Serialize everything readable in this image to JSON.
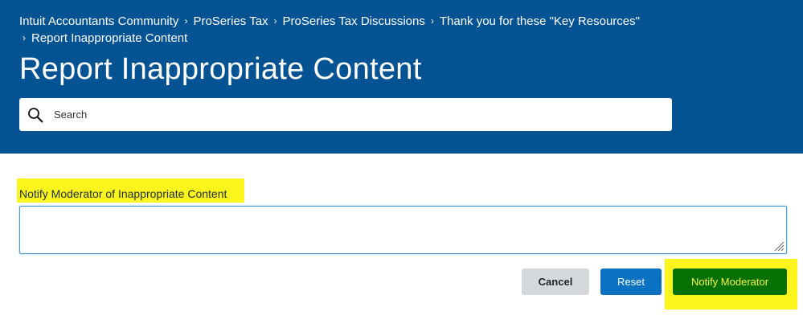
{
  "breadcrumb": {
    "items": [
      "Intuit Accountants Community",
      "ProSeries Tax",
      "ProSeries Tax Discussions",
      "Thank you for these \"Key Resources\"",
      "Report Inappropriate Content"
    ],
    "separator": "›"
  },
  "page": {
    "title": "Report Inappropriate Content"
  },
  "search": {
    "placeholder": "Search",
    "value": ""
  },
  "form": {
    "label": "Notify Moderator of Inappropriate Content",
    "textarea_value": ""
  },
  "buttons": {
    "cancel": "Cancel",
    "reset": "Reset",
    "notify": "Notify Moderator"
  },
  "colors": {
    "header_bg": "#055393",
    "highlight": "#fbf51d",
    "reset_btn": "#0a72c1",
    "notify_btn": "#057105",
    "cancel_btn": "#d5d8dc"
  }
}
